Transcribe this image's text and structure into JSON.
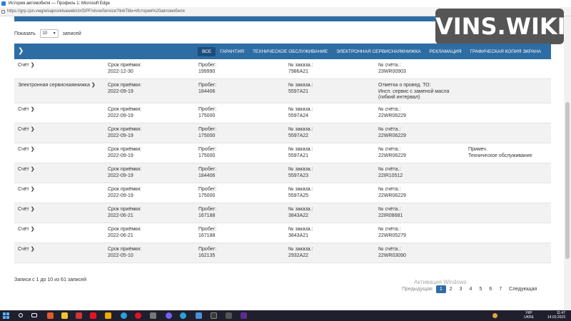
{
  "window": {
    "title": "История автомобиля — Профиль 1: Microsoft Edge",
    "url": "https://grp.cpn.vwg/elsapro/elsaweb/ctr/DPF/showService?linkTitle=История%20автомобиля"
  },
  "badge": "VINS.WIKI",
  "length": {
    "label_show": "Показать",
    "value": "10",
    "label_entries": "записей"
  },
  "tabs": [
    {
      "label": "ВСЕ",
      "active": true
    },
    {
      "label": "ГАРАНТИЯ"
    },
    {
      "label": "ТЕХНИЧЕСКОЕ ОБСЛУЖИВАНИЕ"
    },
    {
      "label": "ЭЛЕКТРОННАЯ СЕРВИСНАЯКНИЖКА"
    },
    {
      "label": "РЕКЛАМАЦИЯ"
    },
    {
      "label": "ГРАФИЧЕСКАЯ КОПИЯ ЭКРАНА"
    }
  ],
  "labels": {
    "date": "Срок приёмки:",
    "mileage": "Пробег:",
    "order": "№ заказа.:",
    "invoice": "№ счёта.:"
  },
  "rows": [
    {
      "type": "Счёт",
      "date": "2022-12-30",
      "mileage": "199990",
      "order": "7986A21",
      "invoice": "23WR00903",
      "note1": "",
      "note2": ""
    },
    {
      "type": "Электронная сервиснаякнижка",
      "date": "2022-09-19",
      "mileage": "184406",
      "order": "5597A21",
      "invoice_l1": "Отметка о провед. ТО:",
      "invoice_l2": "Инсп. сервис с заменой масла",
      "invoice_l3": "(гибкий интервал)"
    },
    {
      "type": "Счёт",
      "date": "2022-09-19",
      "mileage": "175000",
      "order": "5597A24",
      "invoice": "22WR06229"
    },
    {
      "type": "Счёт",
      "date": "2022-09-19",
      "mileage": "175000",
      "order": "5597A22",
      "invoice": "22WR06229"
    },
    {
      "type": "Счёт",
      "date": "2022-09-19",
      "mileage": "175000",
      "order": "5597A21",
      "invoice": "22WR06229",
      "note1": "Примеч.",
      "note2": "Техническое обслуживание"
    },
    {
      "type": "Счёт",
      "date": "2022-09-19",
      "mileage": "184406",
      "order": "5597A23",
      "invoice": "22IR10512"
    },
    {
      "type": "Счёт",
      "date": "2022-09-19",
      "mileage": "175000",
      "order": "5597A25",
      "invoice": "22WR06229"
    },
    {
      "type": "Счёт",
      "date": "2022-06-21",
      "mileage": "167188",
      "order": "3843A22",
      "invoice": "22IR08681"
    },
    {
      "type": "Счёт",
      "date": "2022-06-21",
      "mileage": "167188",
      "order": "3843A21",
      "invoice": "22WR05279"
    },
    {
      "type": "Счёт",
      "date": "2022-05-10",
      "mileage": "162135",
      "order": "2932A22",
      "invoice": "22WR03090"
    }
  ],
  "info": "Записи с 1 до 10 из 61 записей",
  "pager": {
    "prev": "Предыдущая",
    "pages": [
      "1",
      "2",
      "3",
      "4",
      "5",
      "6",
      "7"
    ],
    "active": "1",
    "next": "Следующая"
  },
  "watermark": "Активация Windows",
  "tray": {
    "lang_top": "УКР",
    "lang_bottom": "UKRE",
    "time": "11:47",
    "date": "14.03.2023"
  },
  "colors": {
    "primary": "#2e6da4",
    "active_tab": "#1c4e7d",
    "row_alt": "#f2f2f2",
    "taskbar": "#1f1f2e"
  }
}
